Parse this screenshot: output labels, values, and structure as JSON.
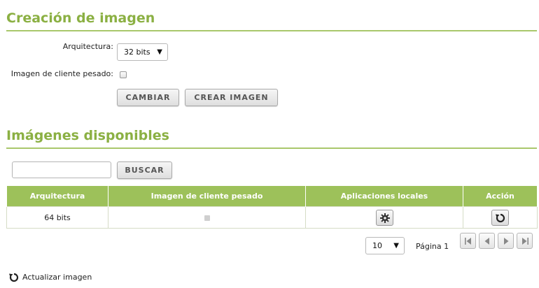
{
  "creation": {
    "title": "Creación de imagen",
    "architecture_label": "Arquitectura:",
    "architecture_value": "32 bits",
    "heavy_client_label": "Imagen de cliente pesado:",
    "heavy_client_checked": false,
    "change_button": "CAMBIAR",
    "create_button": "CREAR IMAGEN"
  },
  "available": {
    "title": "Imágenes disponibles",
    "search_value": "",
    "search_button": "BUSCAR",
    "table": {
      "headers": [
        "Arquitectura",
        "Imagen de cliente pesado",
        "Aplicaciones locales",
        "Acción"
      ],
      "rows": [
        {
          "architecture": "64 bits",
          "heavy_client": false,
          "local_apps_icon": "gear-icon",
          "action_icon": "refresh-icon"
        }
      ]
    },
    "pagination": {
      "page_size": "10",
      "page_label": "Página 1"
    },
    "refresh_link": "Actualizar imagen"
  },
  "colors": {
    "accent": "#8bb043",
    "table_header": "#9dc15a"
  }
}
